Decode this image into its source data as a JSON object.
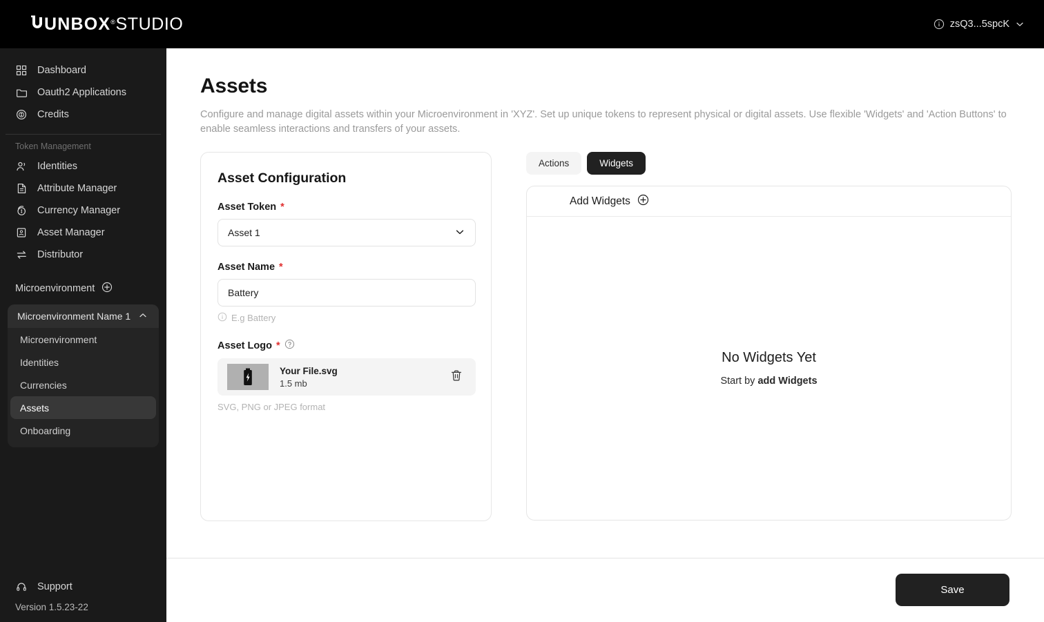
{
  "topbar": {
    "logo_bold": "UNBOX",
    "logo_sup": "®",
    "logo_regular": "STUDIO",
    "user_label": "zsQ3...5spcK",
    "info_icon": "info-circle-icon",
    "chevron_icon": "chevron-down-icon"
  },
  "sidebar": {
    "nav_primary": [
      {
        "label": "Dashboard",
        "icon": "grid-icon"
      },
      {
        "label": "Oauth2 Applications",
        "icon": "folder-icon"
      },
      {
        "label": "Credits",
        "icon": "coin-dollar-icon"
      }
    ],
    "section_label": "Token Management",
    "nav_tokens": [
      {
        "label": "Identities",
        "icon": "users-icon"
      },
      {
        "label": "Attribute Manager",
        "icon": "document-icon"
      },
      {
        "label": "Currency Manager",
        "icon": "currency-coin-icon"
      },
      {
        "label": "Asset Manager",
        "icon": "building-icon"
      },
      {
        "label": "Distributor",
        "icon": "transfer-arrows-icon"
      }
    ],
    "micro_header": "Microenvironment",
    "micro_add_icon": "plus-circle-icon",
    "micro_group": {
      "title": "Microenvironment Name 1",
      "collapse_icon": "chevron-up-icon",
      "items": [
        {
          "label": "Microenvironment",
          "active": false
        },
        {
          "label": "Identities",
          "active": false
        },
        {
          "label": "Currencies",
          "active": false
        },
        {
          "label": "Assets",
          "active": true
        },
        {
          "label": "Onboarding",
          "active": false
        }
      ]
    },
    "support_label": "Support",
    "support_icon": "headset-icon",
    "version": "Version 1.5.23-22"
  },
  "page": {
    "title": "Assets",
    "description": "Configure and manage digital assets within your Microenvironment in 'XYZ'. Set up unique tokens to represent physical or digital assets. Use flexible 'Widgets' and 'Action Buttons' to enable seamless interactions and transfers of your assets."
  },
  "asset_config": {
    "card_title": "Asset Configuration",
    "token_label": "Asset Token",
    "token_required": "*",
    "token_value": "Asset 1",
    "token_chevron_icon": "chevron-down-icon",
    "name_label": "Asset Name",
    "name_required": "*",
    "name_value": "Battery",
    "name_placeholder": "E.g Battery",
    "name_hint": "E.g Battery",
    "name_hint_icon": "info-circle-icon",
    "logo_label": "Asset Logo",
    "logo_required": "*",
    "logo_help_icon": "question-circle-icon",
    "logo_thumb_icon": "battery-bolt-icon",
    "file_name": "Your File.svg",
    "file_size": "1.5 mb",
    "delete_icon": "trash-icon",
    "logo_hint": "SVG, PNG or JPEG format"
  },
  "widgets": {
    "tabs": [
      {
        "label": "Actions",
        "active": false
      },
      {
        "label": "Widgets",
        "active": true
      }
    ],
    "add_label": "Add Widgets",
    "add_icon": "plus-circle-icon",
    "empty_title": "No Widgets Yet",
    "empty_sub_prefix": "Start by ",
    "empty_sub_action": "add Widgets"
  },
  "footer": {
    "save_label": "Save"
  },
  "colors": {
    "topbar_bg": "#000000",
    "sidebar_bg": "#1a1a1a",
    "accent_dark": "#212121",
    "required_red": "#e03030",
    "active_item_bg": "#383838"
  }
}
